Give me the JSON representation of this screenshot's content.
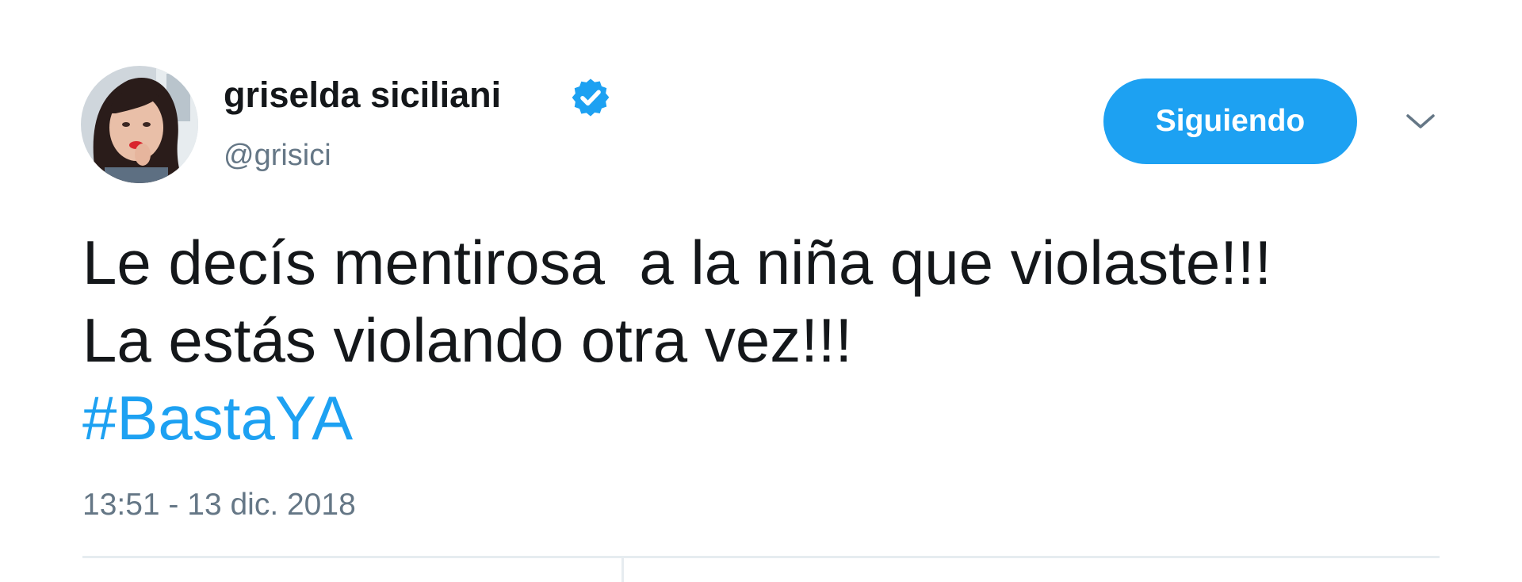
{
  "user": {
    "display_name": "griselda siciliani",
    "handle": "@grisici",
    "verified": true,
    "avatar": "profile-photo"
  },
  "follow_button": {
    "label": "Siguiendo"
  },
  "tweet": {
    "lines": [
      "Le decís mentirosa  a la niña que violaste!!!",
      "La estás violando otra vez!!!"
    ],
    "hashtag": "#BastaYA",
    "timestamp": "13:51 - 13 dic. 2018"
  },
  "icons": {
    "verified": "verified-badge-icon",
    "menu": "chevron-down-icon"
  },
  "colors": {
    "accent": "#1da1f2",
    "text": "#14171a",
    "secondary_text": "#657786",
    "divider": "#e6ecf0"
  }
}
